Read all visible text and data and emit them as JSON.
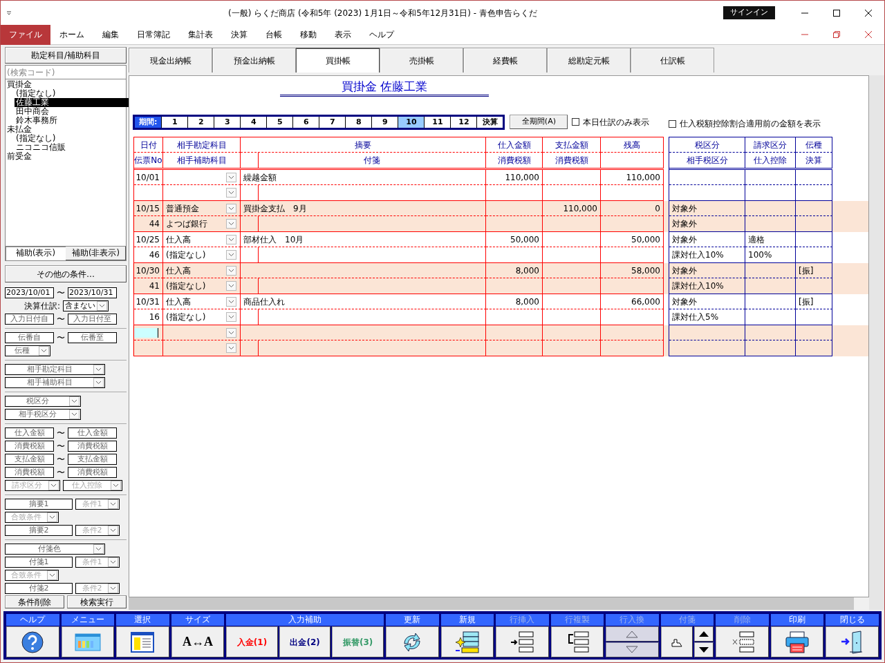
{
  "window": {
    "title": "(一般) らくだ商店 (令和5年 (2023) 1月1日～令和5年12月31日)  -  青色申告らくだ",
    "signin": "サインイン"
  },
  "menu": [
    {
      "label": "ファイル",
      "selected": true
    },
    {
      "label": "ホーム",
      "selected": false
    },
    {
      "label": "編集",
      "selected": false
    },
    {
      "label": "日常簿記",
      "selected": false
    },
    {
      "label": "集計表",
      "selected": false
    },
    {
      "label": "決算",
      "selected": false
    },
    {
      "label": "台帳",
      "selected": false
    },
    {
      "label": "移動",
      "selected": false
    },
    {
      "label": "表示",
      "selected": false
    },
    {
      "label": "ヘルプ",
      "selected": false
    }
  ],
  "sidebar": {
    "header": "勘定科目/補助科目",
    "search": {
      "placeholder": "(検索コード)"
    },
    "tree": [
      {
        "label": "買掛金",
        "selected": false,
        "children": [
          {
            "label": "(指定なし)",
            "selected": false
          },
          {
            "label": "佐藤工業",
            "selected": true
          },
          {
            "label": "田中商会",
            "selected": false
          },
          {
            "label": "鈴木事務所",
            "selected": false
          }
        ]
      },
      {
        "label": "未払金",
        "selected": false,
        "children": [
          {
            "label": "(指定なし)",
            "selected": false
          },
          {
            "label": "ニコニコ信販",
            "selected": false
          }
        ]
      },
      {
        "label": "前受金",
        "selected": false
      }
    ],
    "toggle": [
      {
        "label": "補助(表示)",
        "selected": true
      },
      {
        "label": "補助(非表示)",
        "selected": false
      }
    ],
    "more_button": "その他の条件…",
    "filters": [
      [
        [
          {
            "kind": "input",
            "value": "2023/10/01"
          },
          {
            "kind": "text",
            "text": "〜"
          },
          {
            "kind": "input",
            "value": "2023/10/31"
          }
        ],
        [
          {
            "kind": "text",
            "text": "決算仕訳:"
          },
          {
            "kind": "select",
            "value": "含まない"
          }
        ],
        [
          {
            "kind": "input",
            "placeholder": "入力日付自"
          },
          {
            "kind": "text",
            "text": "〜"
          },
          {
            "kind": "input",
            "placeholder": "入力日付至"
          }
        ]
      ],
      [
        [
          {
            "kind": "input",
            "placeholder": "伝番自"
          },
          {
            "kind": "text",
            "text": "〜"
          },
          {
            "kind": "input",
            "placeholder": "伝番至"
          }
        ],
        [
          {
            "kind": "select",
            "placeholder": "伝種"
          }
        ]
      ],
      [
        [
          {
            "kind": "select",
            "placeholder": "相手勘定科目"
          }
        ],
        [
          {
            "kind": "select",
            "placeholder": "相手補助科目"
          }
        ]
      ],
      [
        [
          {
            "kind": "select",
            "placeholder": "税区分"
          }
        ],
        [
          {
            "kind": "select",
            "placeholder": "相手税区分"
          }
        ]
      ],
      [
        [
          {
            "kind": "input",
            "placeholder": "仕入金額"
          },
          {
            "kind": "text",
            "text": "〜"
          },
          {
            "kind": "input",
            "placeholder": "仕入金額"
          }
        ],
        [
          {
            "kind": "input",
            "placeholder": "消費税額"
          },
          {
            "kind": "text",
            "text": "〜"
          },
          {
            "kind": "input",
            "placeholder": "消費税額"
          }
        ],
        [
          {
            "kind": "input",
            "placeholder": "支払金額"
          },
          {
            "kind": "text",
            "text": "〜"
          },
          {
            "kind": "input",
            "placeholder": "支払金額"
          }
        ],
        [
          {
            "kind": "input",
            "placeholder": "消費税額"
          },
          {
            "kind": "text",
            "text": "〜"
          },
          {
            "kind": "input",
            "placeholder": "消費税額"
          }
        ],
        [
          {
            "kind": "select",
            "placeholder": "請求区分",
            "disabled": true
          },
          {
            "kind": "select",
            "placeholder": "仕入控除",
            "disabled": true
          }
        ]
      ],
      [
        [
          {
            "kind": "input",
            "placeholder": "摘要1"
          },
          {
            "kind": "select",
            "placeholder": "条件1",
            "disabled": true
          }
        ],
        [
          {
            "kind": "select",
            "placeholder": "合致条件",
            "disabled": true
          }
        ],
        [
          {
            "kind": "input",
            "placeholder": "摘要2"
          },
          {
            "kind": "select",
            "placeholder": "条件2",
            "disabled": true
          }
        ]
      ],
      [
        [
          {
            "kind": "select",
            "placeholder": "付箋色"
          }
        ],
        [
          {
            "kind": "input",
            "placeholder": "付箋1"
          },
          {
            "kind": "select",
            "placeholder": "条件1",
            "disabled": true
          }
        ],
        [
          {
            "kind": "select",
            "placeholder": "合致条件",
            "disabled": true
          }
        ],
        [
          {
            "kind": "input",
            "placeholder": "付箋2"
          },
          {
            "kind": "select",
            "placeholder": "条件2",
            "disabled": true
          }
        ]
      ]
    ],
    "buttons": [
      "条件削除",
      "検索実行"
    ]
  },
  "tabs": [
    {
      "label": "現金出納帳",
      "selected": false
    },
    {
      "label": "預金出納帳",
      "selected": false
    },
    {
      "label": "買掛帳",
      "selected": true
    },
    {
      "label": "売掛帳",
      "selected": false
    },
    {
      "label": "経費帳",
      "selected": false
    },
    {
      "label": "総勘定元帳",
      "selected": false
    },
    {
      "label": "仕訳帳",
      "selected": false
    }
  ],
  "ledger_title": "買掛金 佐藤工業",
  "period": {
    "label": "期間:",
    "items": [
      {
        "label": "1",
        "selected": false
      },
      {
        "label": "2",
        "selected": false
      },
      {
        "label": "3",
        "selected": false
      },
      {
        "label": "4",
        "selected": false
      },
      {
        "label": "5",
        "selected": false
      },
      {
        "label": "6",
        "selected": false
      },
      {
        "label": "7",
        "selected": false
      },
      {
        "label": "8",
        "selected": false
      },
      {
        "label": "9",
        "selected": false
      },
      {
        "label": "10",
        "selected": true
      },
      {
        "label": "11",
        "selected": false
      },
      {
        "label": "12",
        "selected": false
      },
      {
        "label": "決算",
        "selected": false
      }
    ],
    "all_button": "全期間(A)"
  },
  "options": [
    {
      "label": "本日仕訳のみ表示",
      "checked": false
    },
    {
      "label": "仕入税額控除割合適用前の金額を表示",
      "checked": false
    }
  ],
  "table": {
    "columns": [
      {
        "top": "日付",
        "bottom": "伝票No"
      },
      {
        "top": "相手勘定科目",
        "bottom": "相手補助科目"
      },
      {
        "top": "摘要",
        "bottom": "付箋"
      },
      {
        "top": "仕入金額",
        "bottom": "消費税額"
      },
      {
        "top": "支払金額",
        "bottom": "消費税額"
      },
      {
        "top": "残高"
      }
    ],
    "side_columns": [
      {
        "top": "税区分",
        "bottom": "相手税区分"
      },
      {
        "top": "請求区分",
        "bottom": "仕入控除"
      },
      {
        "top": "伝種",
        "bottom": "決算"
      }
    ],
    "rows": [
      {
        "kind": "entry",
        "date": "10/01",
        "memo": "繰越金額",
        "purchase": "110,000",
        "balance": "110,000"
      },
      {
        "kind": "entry",
        "date": "10/15",
        "no": "44",
        "account": "普通預金",
        "sub_account": "よつば銀行",
        "memo": "買掛金支払　9月",
        "payment": "110,000",
        "balance": "0",
        "tax_class": "対象外",
        "partner_tax_class": "対象外"
      },
      {
        "kind": "entry",
        "date": "10/25",
        "no": "46",
        "account": "仕入高",
        "sub_account": "(指定なし)",
        "memo": "部材仕入　10月",
        "purchase": "50,000",
        "balance": "50,000",
        "tax_class": "対象外",
        "partner_tax_class": "課対仕入10%",
        "invoice_class": "適格",
        "deduction": "100%"
      },
      {
        "kind": "entry",
        "date": "10/30",
        "no": "41",
        "account": "仕入高",
        "sub_account": "(指定なし)",
        "purchase": "8,000",
        "balance": "58,000",
        "tax_class": "対象外",
        "partner_tax_class": "課対仕入10%",
        "voucher_type": "[振]"
      },
      {
        "kind": "entry",
        "date": "10/31",
        "no": "16",
        "account": "仕入高",
        "sub_account": "(指定なし)",
        "memo": "商品仕入れ",
        "purchase": "8,000",
        "balance": "66,000",
        "tax_class": "対象外",
        "partner_tax_class": "課対仕入5%",
        "voucher_type": "[振]"
      },
      {
        "kind": "new"
      }
    ]
  },
  "toolbar": [
    {
      "label": "ヘルプ",
      "disabled": false,
      "buttons": [
        {
          "kind": "icon"
        }
      ]
    },
    {
      "label": "メニュー",
      "disabled": false,
      "buttons": [
        {
          "kind": "icon"
        }
      ]
    },
    {
      "label": "選択",
      "disabled": false,
      "buttons": [
        {
          "kind": "icon"
        }
      ]
    },
    {
      "label": "サイズ",
      "disabled": false,
      "buttons": [
        {
          "kind": "text",
          "text": "A↔A",
          "color": "#000000"
        }
      ]
    },
    {
      "label": "入力補助",
      "disabled": false,
      "buttons": [
        {
          "kind": "text",
          "text": "入金(1)",
          "color": "#ff0000"
        },
        {
          "kind": "text",
          "text": "出金(2)",
          "color": "#000080"
        },
        {
          "kind": "text",
          "text": "振替(3)",
          "color": "#339966"
        }
      ]
    },
    {
      "label": "更新",
      "disabled": false,
      "buttons": [
        {
          "kind": "icon"
        }
      ]
    },
    {
      "label": "新規",
      "disabled": false,
      "buttons": [
        {
          "kind": "icon"
        }
      ]
    },
    {
      "label": "行挿入",
      "disabled": true,
      "buttons": [
        {
          "kind": "icon"
        }
      ]
    },
    {
      "label": "行複製",
      "disabled": true,
      "buttons": [
        {
          "kind": "icon"
        }
      ]
    },
    {
      "label": "行入換",
      "disabled": true,
      "buttons": [
        {
          "kind": "icon"
        },
        {
          "kind": "icon"
        }
      ]
    },
    {
      "label": "付箋",
      "disabled": true,
      "buttons": [
        {
          "kind": "icon"
        },
        {
          "kind": "icon"
        },
        {
          "kind": "icon"
        }
      ]
    },
    {
      "label": "削除",
      "disabled": true,
      "buttons": [
        {
          "kind": "icon"
        }
      ]
    },
    {
      "label": "印刷",
      "disabled": false,
      "buttons": [
        {
          "kind": "icon"
        }
      ]
    },
    {
      "label": "閉じる",
      "disabled": false,
      "buttons": [
        {
          "kind": "icon"
        }
      ]
    }
  ]
}
